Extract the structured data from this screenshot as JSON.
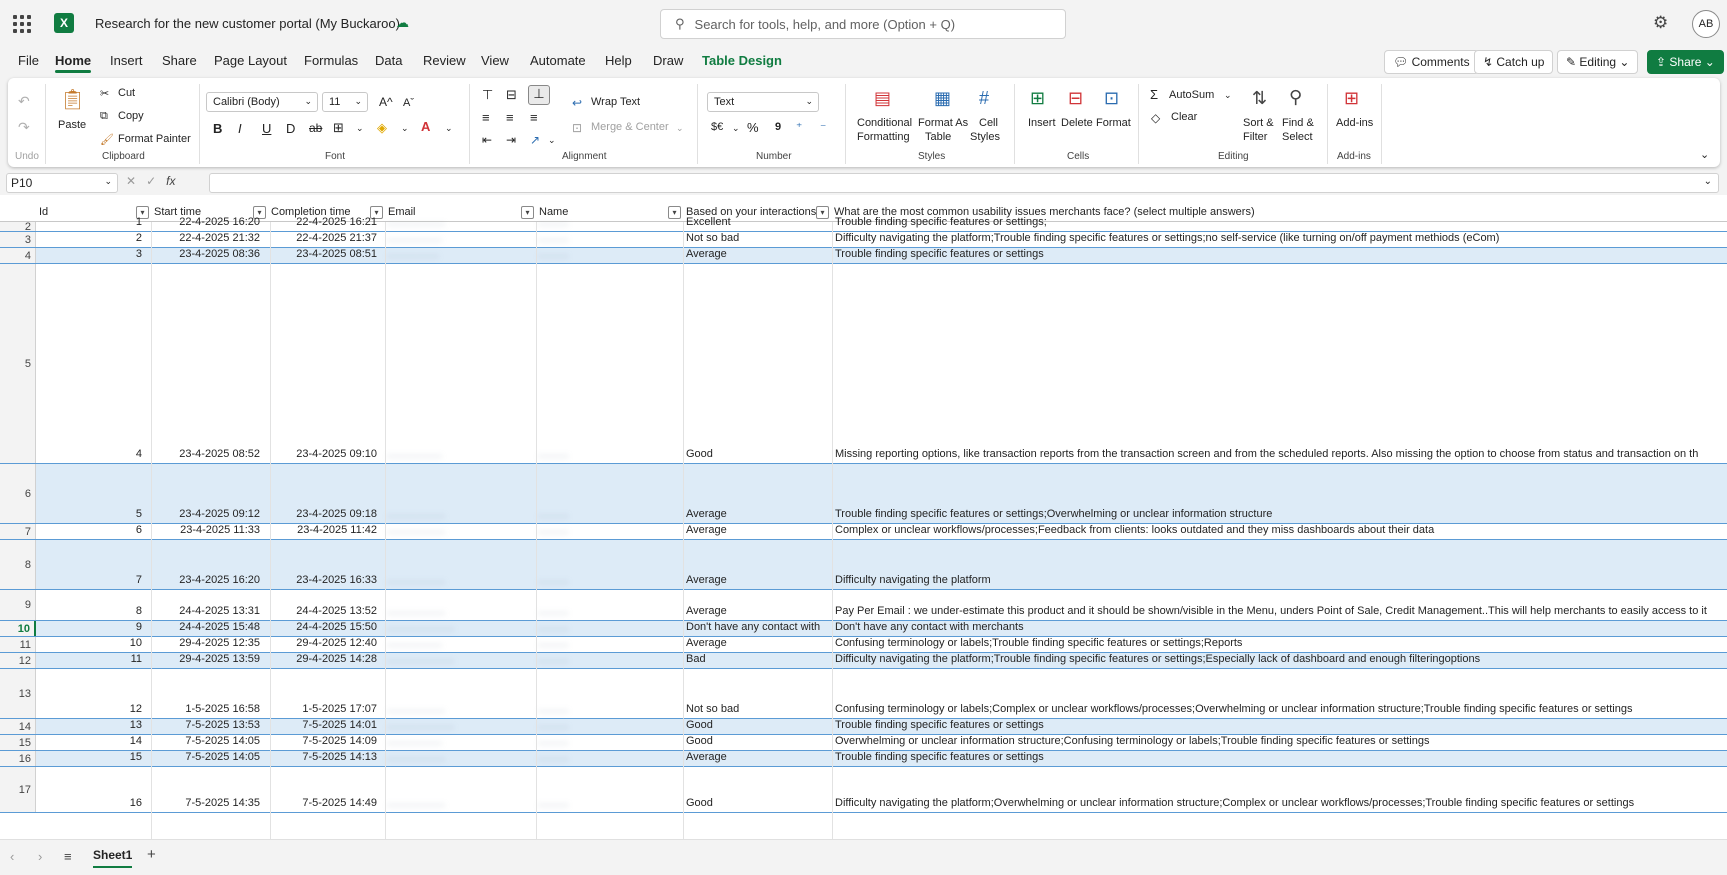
{
  "app": {
    "doc_title": "Research for the new customer portal (My Buckaroo)",
    "logo_letter": "X",
    "search_placeholder": "Search for tools, help, and more (Option + Q)",
    "avatar": "AB"
  },
  "menu": [
    "File",
    "Home",
    "Insert",
    "Share",
    "Page Layout",
    "Formulas",
    "Data",
    "Review",
    "View",
    "Automate",
    "Help",
    "Draw",
    "Table Design"
  ],
  "right_buttons": {
    "comments": "Comments",
    "catchup": "Catch up",
    "editing": "Editing",
    "share": "Share"
  },
  "ribbon": {
    "undo_label": "Undo",
    "clipboard": {
      "paste": "Paste",
      "cut": "Cut",
      "copy": "Copy",
      "format_painter": "Format Painter",
      "label": "Clipboard"
    },
    "font": {
      "name": "Calibri (Body)",
      "size": "11",
      "label": "Font"
    },
    "alignment": {
      "wrap": "Wrap Text",
      "merge": "Merge & Center",
      "label": "Alignment"
    },
    "number": {
      "format": "Text",
      "currency": "$€",
      "percent": "%",
      "comma": "9",
      "label": "Number"
    },
    "styles": {
      "conditional": "Conditional",
      "conditional2": "Formatting",
      "format_table": "Format As",
      "format_table2": "Table",
      "cell_styles": "Cell",
      "cell_styles2": "Styles",
      "label": "Styles"
    },
    "cells": {
      "insert": "Insert",
      "delete": "Delete",
      "format": "Format",
      "label": "Cells"
    },
    "editing": {
      "autosum": "AutoSum",
      "clear": "Clear",
      "sort": "Sort &",
      "sort2": "Filter",
      "find": "Find &",
      "find2": "Select",
      "label": "Editing"
    },
    "addins": {
      "addins": "Add-ins",
      "label": "Add-ins"
    }
  },
  "formula_bar": {
    "name_box": "P10",
    "fx": "fx",
    "value": ""
  },
  "columns": [
    "Id",
    "Start time",
    "Completion time",
    "Email",
    "Name",
    "Based on your interactions",
    "What are the most common usability issues merchants face? (select multiple answers)"
  ],
  "rows": [
    {
      "n": "2",
      "id": "1",
      "start": "22-4-2025 16:20",
      "end": "22-4-2025 16:21",
      "email": "...................",
      "name": "..........",
      "rating": "Excellent",
      "answer": "Trouble finding specific features or settings;"
    },
    {
      "n": "3",
      "id": "2",
      "start": "22-4-2025 21:32",
      "end": "22-4-2025 21:37",
      "email": "..................",
      "name": "..........",
      "rating": "Not so bad",
      "answer": "Difficulty navigating the platform;Trouble finding specific features or settings;no self-service (like turning on/off payment methiods (eCom)"
    },
    {
      "n": "4",
      "id": "3",
      "start": "23-4-2025 08:36",
      "end": "23-4-2025 08:51",
      "email": ".................",
      "name": "..........",
      "rating": "Average",
      "answer": "Trouble finding specific features or settings"
    },
    {
      "n": "5",
      "id": "4",
      "start": "23-4-2025 08:52",
      "end": "23-4-2025 09:10",
      "email": "..................",
      "name": "..........",
      "rating": "Good",
      "answer": "Missing reporting options, like transaction reports from the transaction screen and from the scheduled reports. Also missing the option to choose from status and transaction on th"
    },
    {
      "n": "6",
      "id": "5",
      "start": "23-4-2025 09:12",
      "end": "23-4-2025 09:18",
      "email": "...................",
      "name": "..........",
      "rating": "Average",
      "answer": "Trouble finding specific features or settings;Overwhelming or unclear information structure"
    },
    {
      "n": "7",
      "id": "6",
      "start": "23-4-2025 11:33",
      "end": "23-4-2025 11:42",
      "email": "...................",
      "name": "..........",
      "rating": "Average",
      "answer": "Complex or unclear workflows/processes;Feedback from clients: looks outdated and they miss dashboards about their data"
    },
    {
      "n": "8",
      "id": "7",
      "start": "23-4-2025 16:20",
      "end": "23-4-2025 16:33",
      "email": "...................",
      "name": "..........",
      "rating": "Average",
      "answer": "Difficulty navigating the platform"
    },
    {
      "n": "9",
      "id": "8",
      "start": "24-4-2025 13:31",
      "end": "24-4-2025 13:52",
      "email": "...................",
      "name": "..........",
      "rating": "Average",
      "answer": "Pay Per Email : we under-estimate this product and it should be shown/visible in the Menu, unders Point of Sale, Credit Management..This will help merchants to easily access to it"
    },
    {
      "n": "10",
      "id": "9",
      "start": "24-4-2025 15:48",
      "end": "24-4-2025 15:50",
      "email": "......................",
      "name": "..........",
      "rating": "Don't have any contact with m",
      "answer": "Don't have any contact with merchants"
    },
    {
      "n": "11",
      "id": "10",
      "start": "29-4-2025 12:35",
      "end": "29-4-2025 12:40",
      "email": "..................",
      "name": "..........",
      "rating": "Average",
      "answer": "Confusing terminology or labels;Trouble finding specific features or settings;Reports"
    },
    {
      "n": "12",
      "id": "11",
      "start": "29-4-2025 13:59",
      "end": "29-4-2025 14:28",
      "email": "......................",
      "name": "..........",
      "rating": "Bad",
      "answer": "Difficulty navigating the platform;Trouble finding specific features or settings;Especially lack of dashboard and enough filteringoptions"
    },
    {
      "n": "13",
      "id": "12",
      "start": "1-5-2025 16:58",
      "end": "1-5-2025 17:07",
      "email": "...................",
      "name": "..........",
      "rating": "Not so bad",
      "answer": "Confusing terminology or labels;Complex or unclear workflows/processes;Overwhelming or unclear information structure;Trouble finding specific features or settings"
    },
    {
      "n": "14",
      "id": "13",
      "start": "7-5-2025 13:53",
      "end": "7-5-2025 14:01",
      "email": "......................",
      "name": "..........",
      "rating": "Good",
      "answer": "Trouble finding specific features or settings"
    },
    {
      "n": "15",
      "id": "14",
      "start": "7-5-2025 14:05",
      "end": "7-5-2025 14:09",
      "email": "..................",
      "name": "..........",
      "rating": "Good",
      "answer": "Overwhelming or unclear information structure;Confusing terminology or labels;Trouble finding specific features or settings"
    },
    {
      "n": "16",
      "id": "15",
      "start": "7-5-2025 14:05",
      "end": "7-5-2025 14:13",
      "email": "...................",
      "name": "..........",
      "rating": "Average",
      "answer": "Trouble finding specific features or settings"
    },
    {
      "n": "17",
      "id": "16",
      "start": "7-5-2025 14:35",
      "end": "7-5-2025 14:49",
      "email": "...................",
      "name": "..........",
      "rating": "Good",
      "answer": "Difficulty navigating the platform;Overwhelming or unclear information structure;Complex or unclear workflows/processes;Trouble finding specific features or settings"
    }
  ],
  "sheet": {
    "name": "Sheet1",
    "add": "+"
  }
}
